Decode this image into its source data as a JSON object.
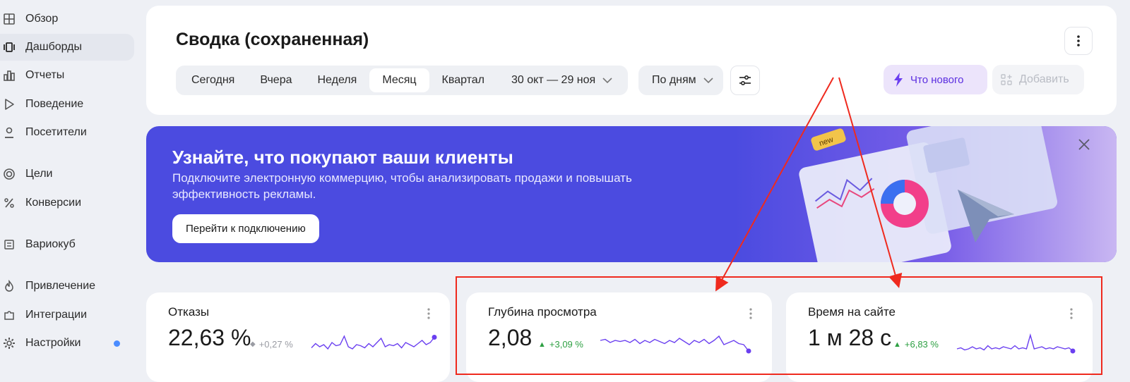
{
  "sidebar": {
    "items": [
      {
        "label": "Обзор",
        "icon": "grid-icon",
        "active": false
      },
      {
        "label": "Дашборды",
        "icon": "dashboards-icon",
        "active": true
      },
      {
        "label": "Отчеты",
        "icon": "bar-chart-icon",
        "active": false
      },
      {
        "label": "Поведение",
        "icon": "play-icon",
        "active": false
      },
      {
        "label": "Посетители",
        "icon": "user-icon",
        "active": false
      },
      {
        "label": "Цели",
        "icon": "target-icon",
        "active": false
      },
      {
        "label": "Конверсии",
        "icon": "percent-icon",
        "active": false
      },
      {
        "label": "Вариокуб",
        "icon": "cube-list-icon",
        "active": false
      },
      {
        "label": "Привлечение",
        "icon": "flame-icon",
        "active": false
      },
      {
        "label": "Интеграции",
        "icon": "puzzle-icon",
        "active": false
      },
      {
        "label": "Настройки",
        "icon": "gear-icon",
        "active": false,
        "badge_color": "#4a8cff"
      }
    ]
  },
  "header": {
    "title": "Сводка (сохраненная)",
    "periods": [
      "Сегодня",
      "Вчера",
      "Неделя",
      "Месяц",
      "Квартал"
    ],
    "active_period": "Месяц",
    "date_range": "30 окт — 29 ноя",
    "grouping": "По дням",
    "whats_new_label": "Что нового",
    "add_label": "Добавить",
    "accent_color": "#5b2ee0"
  },
  "banner": {
    "title": "Узнайте, что покупают ваши клиенты",
    "text": "Подключите электронную коммерцию, чтобы анализировать продажи и повышать эффективность рекламы.",
    "button_label": "Перейти к подключению",
    "sticker": "new",
    "bg_color": "#4b4be0"
  },
  "metrics": [
    {
      "title": "Отказы",
      "value": "22,63 %",
      "delta": "+0,27 %",
      "trend": "neutral",
      "delta_color": "#9a9ca3"
    },
    {
      "title": "Глубина просмотра",
      "value": "2,08",
      "delta": "+3,09 %",
      "trend": "up",
      "delta_color": "#2ea043"
    },
    {
      "title": "Время на сайте",
      "value": "1 м 28 с",
      "delta": "+6,83 %",
      "trend": "up",
      "delta_color": "#2ea043"
    }
  ],
  "sparklines": [
    [
      0.35,
      0.55,
      0.4,
      0.5,
      0.3,
      0.6,
      0.45,
      0.5,
      0.9,
      0.4,
      0.3,
      0.5,
      0.45,
      0.35,
      0.55,
      0.4,
      0.6,
      0.8,
      0.4,
      0.5,
      0.45,
      0.55,
      0.35,
      0.6,
      0.5,
      0.4,
      0.55,
      0.7,
      0.5,
      0.6,
      0.85
    ],
    [
      0.7,
      0.75,
      0.6,
      0.7,
      0.65,
      0.7,
      0.6,
      0.75,
      0.55,
      0.7,
      0.6,
      0.75,
      0.65,
      0.55,
      0.7,
      0.6,
      0.8,
      0.65,
      0.5,
      0.7,
      0.6,
      0.75,
      0.55,
      0.7,
      0.9,
      0.5,
      0.6,
      0.7,
      0.55,
      0.5,
      0.2
    ],
    [
      0.3,
      0.35,
      0.25,
      0.3,
      0.4,
      0.3,
      0.35,
      0.25,
      0.45,
      0.3,
      0.35,
      0.3,
      0.4,
      0.35,
      0.3,
      0.45,
      0.3,
      0.35,
      0.3,
      0.95,
      0.3,
      0.35,
      0.4,
      0.3,
      0.35,
      0.3,
      0.4,
      0.35,
      0.3,
      0.35,
      0.2
    ]
  ]
}
